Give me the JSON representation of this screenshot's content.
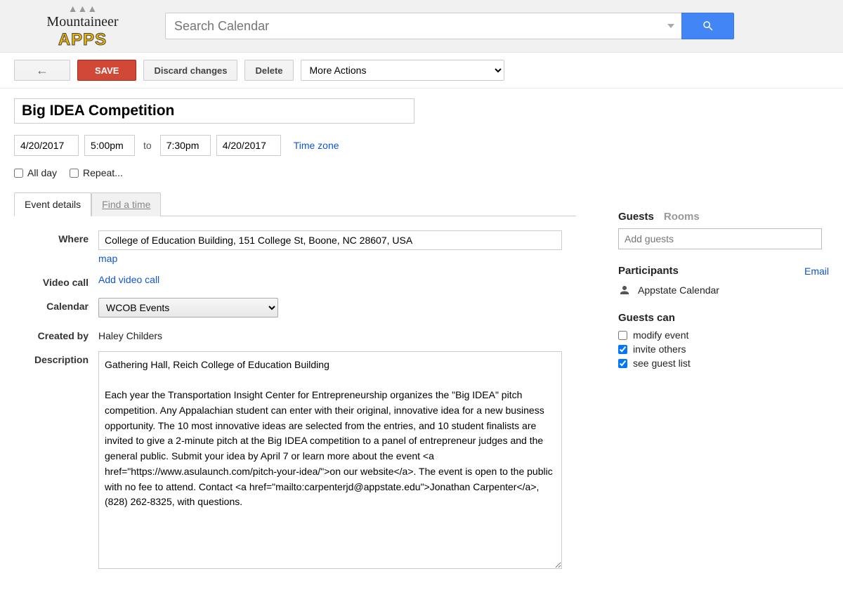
{
  "header": {
    "logo_script": "Mountaineer",
    "logo_apps": "APPS",
    "search_placeholder": "Search Calendar"
  },
  "toolbar": {
    "save": "SAVE",
    "discard": "Discard changes",
    "delete": "Delete",
    "more_actions": "More Actions"
  },
  "event": {
    "title": "Big IDEA Competition",
    "start_date": "4/20/2017",
    "start_time": "5:00pm",
    "to": "to",
    "end_time": "7:30pm",
    "end_date": "4/20/2017",
    "timezone_link": "Time zone",
    "all_day": "All day",
    "repeat": "Repeat..."
  },
  "tabs": {
    "details": "Event details",
    "find_time": "Find a time"
  },
  "details": {
    "where_label": "Where",
    "where_value": "College of Education Building, 151 College St, Boone, NC 28607, USA",
    "map_link": "map",
    "video_label": "Video call",
    "video_link": "Add video call",
    "calendar_label": "Calendar",
    "calendar_value": "WCOB Events",
    "created_by_label": "Created by",
    "created_by_value": "Haley Childers",
    "description_label": "Description",
    "description_value": "Gathering Hall, Reich College of Education Building\n\nEach year the Transportation Insight Center for Entrepreneurship organizes the \"Big IDEA\" pitch competition. Any Appalachian student can enter with their original, innovative idea for a new business opportunity. The 10 most innovative ideas are selected from the entries, and 10 student finalists are invited to give a 2-minute pitch at the Big IDEA competition to a panel of entrepreneur judges and the general public. Submit your idea by April 7 or learn more about the event <a href=\"https://www.asulaunch.com/pitch-your-idea/\">on our website</a>. The event is open to the public with no fee to attend. Contact <a href=\"mailto:carpenterjd@appstate.edu\">Jonathan Carpenter</a>, (828) 262-8325, with questions."
  },
  "sidebar": {
    "guests_tab": "Guests",
    "rooms_tab": "Rooms",
    "add_guests_placeholder": "Add guests",
    "participants_title": "Participants",
    "email_link": "Email",
    "participant_name": "Appstate Calendar",
    "guests_can_title": "Guests can",
    "perm_modify": "modify event",
    "perm_invite": "invite others",
    "perm_see": "see guest list"
  }
}
